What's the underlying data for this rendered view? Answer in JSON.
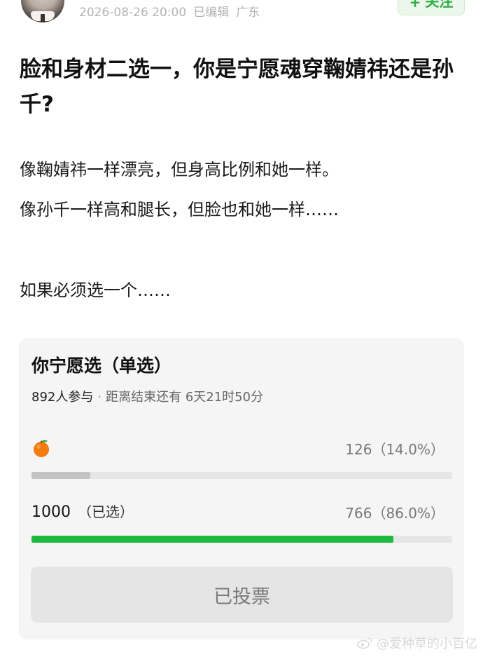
{
  "post": {
    "timestamp": "2026-08-26 20:00",
    "edited": "已编辑",
    "location": "广东",
    "follow_label": "关注",
    "title": "脸和身材二选一，你是宁愿魂穿鞠婧祎还是孙千?",
    "body_lines": [
      "像鞠婧祎一样漂亮，但身高比例和她一样。",
      "像孙千一样高和腿长，但脸也和她一样……",
      "如果必须选一个……"
    ]
  },
  "poll": {
    "title": "你宁愿选（单选）",
    "participants": "892人参与",
    "deadline": "距离结束还有 6天21时50分",
    "options": [
      {
        "icon": "orange-emoji-icon",
        "label": "",
        "stat": "126（14.0%）",
        "fraction": 0.14,
        "color": "#c4c4c4"
      },
      {
        "icon": "",
        "label": "1000",
        "tag": "（已选）",
        "stat": "766（86.0%）",
        "fraction": 0.86,
        "color": "#1fb941"
      }
    ],
    "vote_button_label": "已投票"
  },
  "watermark": {
    "text": "@爱种草的小百亿",
    "icon": "weibo-icon"
  },
  "colors": {
    "accent_green": "#1fb941",
    "follow_green": "#2fae45",
    "muted_gray": "#b4b4b4"
  }
}
